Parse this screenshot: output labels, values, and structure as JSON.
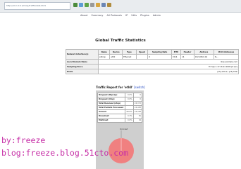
{
  "browser": {
    "address": "http://10.1.10.1/ntop/trafficstats.html"
  },
  "menu": [
    "About",
    "Summary",
    "All Protocols",
    "IP",
    "Utils",
    "Plugins",
    "Admin"
  ],
  "global": {
    "title": "Global Traffic Statistics",
    "headers": [
      "Name",
      "Device",
      "Type",
      "Speed",
      "Sampling Rate",
      "MTU",
      "Header",
      "Address",
      "IPv6 Addresses"
    ],
    "row_label": "Network Interface(s)",
    "row": [
      "pktcap",
      "eth0",
      "Ethernet",
      "",
      "0",
      "1514",
      "14",
      "192.168.0.16",
      "fe..."
    ],
    "local_domain_label": "Local Domain Name",
    "local_domain_value": "ntop.example.com",
    "sampling_label": "Sampling Since",
    "sampling_value": "Fri Sep 4 17:16:24 2009 [0 sec]",
    "hosts_label": "Hosts",
    "hosts_value": "[15] active / [15] total"
  },
  "report": {
    "title": "Traffic Report for 'eth0'",
    "selector": "[switch]",
    "counters": [
      {
        "label": "Dropped (libpcap)",
        "pct": "0.0%",
        "value": "0"
      },
      {
        "label": "Dropped (ntop)",
        "pct": "0.0%",
        "value": "0"
      },
      {
        "label": "Total Received (ntop)",
        "pct": "",
        "value": "24,372"
      },
      {
        "label": "Total Packets Processed",
        "pct": "",
        "value": "24,483"
      },
      {
        "label": "Unicast",
        "pct": "99.6%",
        "value": "24,383"
      },
      {
        "label": "Broadcast",
        "pct": "0.3%",
        "value": "81"
      },
      {
        "label": "Multicast",
        "pct": "0.0%",
        "value": "19"
      }
    ],
    "pie_label": "Unicast"
  },
  "watermark": {
    "line1": "by:freeze",
    "line2": "blog:freeze.blog.51cto.com"
  },
  "colors": {
    "pie": "#f08080",
    "watermark": "#c62ea6"
  }
}
